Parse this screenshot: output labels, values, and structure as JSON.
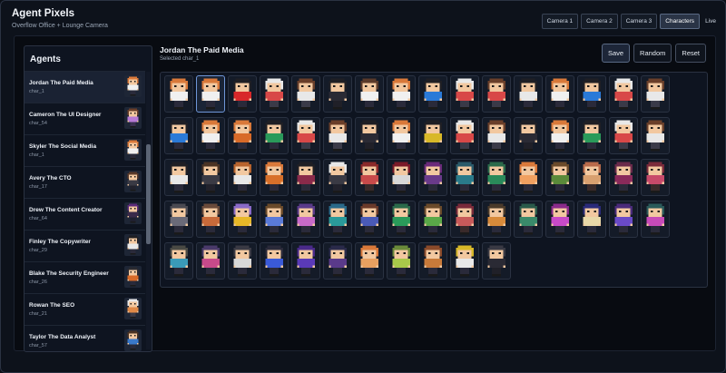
{
  "app": {
    "title": "Agent Pixels",
    "subtitle": "Overflow Office + Lounge Camera"
  },
  "tabs": [
    {
      "label": "Camera 1",
      "active": false
    },
    {
      "label": "Camera 2",
      "active": false
    },
    {
      "label": "Camera 3",
      "active": false
    },
    {
      "label": "Characters",
      "active": true
    }
  ],
  "status": {
    "live_label": "Live"
  },
  "sidebar": {
    "title": "Agents",
    "agents": [
      {
        "name": "Jordan The Paid Media",
        "char": "char_1",
        "selected": true,
        "hair": "#d9793a",
        "shirt": "#f0f0f0",
        "pants": "#2a2a3a"
      },
      {
        "name": "Cameron The UI Designer",
        "char": "char_54",
        "selected": false,
        "hair": "#6a3f2a",
        "shirt": "#b77ad6",
        "pants": "#3a3050"
      },
      {
        "name": "Skyler The Social Media",
        "char": "char_1",
        "selected": false,
        "hair": "#d9793a",
        "shirt": "#f0f0f0",
        "pants": "#2a2a3a"
      },
      {
        "name": "Avery The CTO",
        "char": "char_17",
        "selected": false,
        "hair": "#5a3a2a",
        "shirt": "#3a3a44",
        "pants": "#22222c"
      },
      {
        "name": "Drew The Content Creator",
        "char": "char_64",
        "selected": false,
        "hair": "#5a2a7a",
        "shirt": "#3a2a4a",
        "pants": "#202030"
      },
      {
        "name": "Finley The Copywriter",
        "char": "char_29",
        "selected": false,
        "hair": "#1f1f24",
        "shirt": "#e8e8e8",
        "pants": "#2a2a3a"
      },
      {
        "name": "Blake The Security Engineer",
        "char": "char_26",
        "selected": false,
        "hair": "#2a2a30",
        "shirt": "#d86a28",
        "pants": "#2a2a3a"
      },
      {
        "name": "Rowan The SEO",
        "char": "char_21",
        "selected": false,
        "hair": "#e8e8e8",
        "shirt": "#e08a48",
        "pants": "#3a3a48"
      },
      {
        "name": "Taylor The Data Analyst",
        "char": "char_57",
        "selected": false,
        "hair": "#4a3324",
        "shirt": "#3a78c8",
        "pants": "#2a2a3a"
      }
    ]
  },
  "main": {
    "selected_name": "Jordan The Paid Media",
    "selected_label": "Selected char_1",
    "buttons": {
      "save": "Save",
      "random": "Random",
      "reset": "Reset"
    }
  },
  "characters": [
    {
      "hair": "#d9793a",
      "shirt": "#f0f0f0",
      "pants": "#2a2a3a"
    },
    {
      "hair": "#d9793a",
      "shirt": "#f0f0f0",
      "pants": "#2a2a3a",
      "selected": true
    },
    {
      "hair": "#1f1f24",
      "shirt": "#d8282a",
      "pants": "#2a2a3a"
    },
    {
      "hair": "#e8e8e8",
      "shirt": "#d84848",
      "pants": "#3a3a48"
    },
    {
      "hair": "#6a3f2a",
      "shirt": "#e8e8e8",
      "pants": "#3a3a48"
    },
    {
      "hair": "#1f1f24",
      "shirt": "#2a2a34",
      "pants": "#202028"
    },
    {
      "hair": "#5a3a2a",
      "shirt": "#f0f0f0",
      "pants": "#2a2a3a"
    },
    {
      "hair": "#d9793a",
      "shirt": "#f0f0f0",
      "pants": "#2a2a3a"
    },
    {
      "hair": "#1f1f24",
      "shirt": "#2a7ad8",
      "pants": "#2a2a3a"
    },
    {
      "hair": "#e8e8e8",
      "shirt": "#d84848",
      "pants": "#3a3a48"
    },
    {
      "hair": "#6a3f2a",
      "shirt": "#d84848",
      "pants": "#3a3a48"
    },
    {
      "hair": "#1f1f24",
      "shirt": "#e8e8e8",
      "pants": "#2a2a3a"
    },
    {
      "hair": "#d9793a",
      "shirt": "#f0f0f0",
      "pants": "#2a2a3a"
    },
    {
      "hair": "#1f1f24",
      "shirt": "#2a7ad8",
      "pants": "#2a2a3a"
    },
    {
      "hair": "#e8e8e8",
      "shirt": "#d84848",
      "pants": "#3a3a48"
    },
    {
      "hair": "#6a3f2a",
      "shirt": "#e8e8e8",
      "pants": "#3a3a48"
    },
    {
      "hair": "#1f1f24",
      "shirt": "#2a7ad8",
      "pants": "#2a2a3a"
    },
    {
      "hair": "#d9793a",
      "shirt": "#f0f0f0",
      "pants": "#2a2a3a"
    },
    {
      "hair": "#d9793a",
      "shirt": "#d86a28",
      "pants": "#2a2a3a"
    },
    {
      "hair": "#1f1f24",
      "shirt": "#2a9a5a",
      "pants": "#2a2a3a"
    },
    {
      "hair": "#e8e8e8",
      "shirt": "#d84848",
      "pants": "#3a3a48"
    },
    {
      "hair": "#6a3f2a",
      "shirt": "#e8e8e8",
      "pants": "#3a3a48"
    },
    {
      "hair": "#1f1f24",
      "shirt": "#2a2a34",
      "pants": "#202028"
    },
    {
      "hair": "#d9793a",
      "shirt": "#f0f0f0",
      "pants": "#2a2a3a"
    },
    {
      "hair": "#1f1f24",
      "shirt": "#d8b828",
      "pants": "#2a2a3a"
    },
    {
      "hair": "#e8e8e8",
      "shirt": "#d84848",
      "pants": "#3a3a48"
    },
    {
      "hair": "#6a3f2a",
      "shirt": "#e8e8e8",
      "pants": "#3a3a48"
    },
    {
      "hair": "#1f1f24",
      "shirt": "#2a2a34",
      "pants": "#202028"
    },
    {
      "hair": "#d9793a",
      "shirt": "#f0f0f0",
      "pants": "#2a2a3a"
    },
    {
      "hair": "#1f1f24",
      "shirt": "#2a9a5a",
      "pants": "#2a2a3a"
    },
    {
      "hair": "#e8e8e8",
      "shirt": "#d84848",
      "pants": "#3a3a48"
    },
    {
      "hair": "#6a3f2a",
      "shirt": "#e8e8e8",
      "pants": "#3a3a48"
    },
    {
      "hair": "#1f1f24",
      "shirt": "#e8e8e8",
      "pants": "#2a2a3a"
    },
    {
      "hair": "#4a3324",
      "shirt": "#3a3a44",
      "pants": "#22222c"
    },
    {
      "hair": "#b8642e",
      "shirt": "#e8e8e8",
      "pants": "#2a2a3a"
    },
    {
      "hair": "#d9793a",
      "shirt": "#d8702a",
      "pants": "#2a2a3a"
    },
    {
      "hair": "#1f1f24",
      "shirt": "#8a2a4a",
      "pants": "#2a2a3a"
    },
    {
      "hair": "#e8e8e8",
      "shirt": "#3a3a44",
      "pants": "#22222c"
    },
    {
      "hair": "#8a2a2a",
      "shirt": "#c84a4a",
      "pants": "#3a2a2a"
    },
    {
      "hair": "#7a1a28",
      "shirt": "#d8d8d8",
      "pants": "#2a2a3a"
    },
    {
      "hair": "#6a2a7a",
      "shirt": "#6a3a8a",
      "pants": "#2a2a3a"
    },
    {
      "hair": "#2a5a6a",
      "shirt": "#2a7a8a",
      "pants": "#2a2a3a"
    },
    {
      "hair": "#2a6a4a",
      "shirt": "#2a8a5a",
      "pants": "#2a2a3a"
    },
    {
      "hair": "#d9793a",
      "shirt": "#f0a060",
      "pants": "#2a2a3a"
    },
    {
      "hair": "#6a4a2a",
      "shirt": "#5a8a3a",
      "pants": "#2a2a3a"
    },
    {
      "hair": "#b86a4a",
      "shirt": "#d8a070",
      "pants": "#3a2a2a"
    },
    {
      "hair": "#6a2a4a",
      "shirt": "#8a2a5a",
      "pants": "#2a2a3a"
    },
    {
      "hair": "#7a2a3a",
      "shirt": "#c84a6a",
      "pants": "#3a2a2a"
    },
    {
      "hair": "#4a4a52",
      "shirt": "#6a6a78",
      "pants": "#2a2a3a"
    },
    {
      "hair": "#6a4a3a",
      "shirt": "#c86a3a",
      "pants": "#2a2a3a"
    },
    {
      "hair": "#8a6ac8",
      "shirt": "#e8b828",
      "pants": "#2a2a3a"
    },
    {
      "hair": "#6a4a2a",
      "shirt": "#5a7ad8",
      "pants": "#2a2a3a"
    },
    {
      "hair": "#5a3a8a",
      "shirt": "#c86ac8",
      "pants": "#2a2a3a"
    },
    {
      "hair": "#2a6a8a",
      "shirt": "#2a9a9a",
      "pants": "#2a2a3a"
    },
    {
      "hair": "#6a3a2a",
      "shirt": "#4a5ab8",
      "pants": "#2a2a3a"
    },
    {
      "hair": "#2a6a4a",
      "shirt": "#2a9a5a",
      "pants": "#2a2a3a"
    },
    {
      "hair": "#6a4a2a",
      "shirt": "#5aa848",
      "pants": "#2a2a3a"
    },
    {
      "hair": "#7a2a3a",
      "shirt": "#c85a5a",
      "pants": "#3a2a2a"
    },
    {
      "hair": "#4a3a2a",
      "shirt": "#d88a3a",
      "pants": "#2a2a3a"
    },
    {
      "hair": "#2a5a4a",
      "shirt": "#3a8a6a",
      "pants": "#2a2a3a"
    },
    {
      "hair": "#8a2a8a",
      "shirt": "#c84ac8",
      "pants": "#2a2a3a"
    },
    {
      "hair": "#2a2a7a",
      "shirt": "#e8d8a8",
      "pants": "#2a2a3a"
    },
    {
      "hair": "#4a2a7a",
      "shirt": "#6a4ac8",
      "pants": "#2a2a3a"
    },
    {
      "hair": "#2a5a5a",
      "shirt": "#c84ab8",
      "pants": "#2a2a3a"
    },
    {
      "hair": "#4a4a44",
      "shirt": "#3a9ab8",
      "pants": "#2a2a3a"
    },
    {
      "hair": "#4a3a6a",
      "shirt": "#c84a8a",
      "pants": "#2a2a3a"
    },
    {
      "hair": "#3a3a44",
      "shirt": "#d8d8d8",
      "pants": "#2a2a3a"
    },
    {
      "hair": "#2a2a3a",
      "shirt": "#3a5ad8",
      "pants": "#2a2a3a"
    },
    {
      "hair": "#4a2a8a",
      "shirt": "#5a3ab8",
      "pants": "#2a2a3a"
    },
    {
      "hair": "#2a2a4a",
      "shirt": "#5a3a8a",
      "pants": "#2a2a3a"
    },
    {
      "hair": "#d9793a",
      "shirt": "#e8a060",
      "pants": "#2a2a3a"
    },
    {
      "hair": "#6a8a3a",
      "shirt": "#a8c84a",
      "pants": "#2a2a3a"
    },
    {
      "hair": "#8a4a2a",
      "shirt": "#c87a3a",
      "pants": "#2a2a3a"
    },
    {
      "hair": "#d8b828",
      "shirt": "#e8e8e8",
      "pants": "#2a2a3a"
    },
    {
      "hair": "#3a3a44",
      "shirt": "#2a2a34",
      "pants": "#202028"
    }
  ]
}
